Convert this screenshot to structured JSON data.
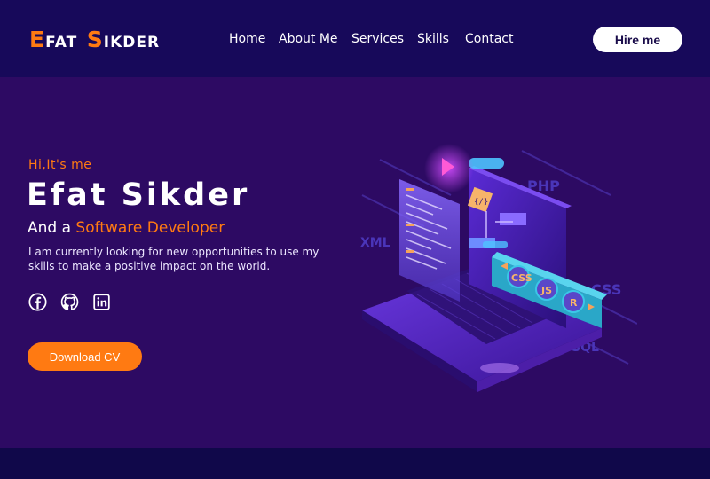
{
  "header": {
    "logo": {
      "first_initial": "E",
      "first_rest": "FAT",
      "last_initial": "S",
      "last_rest": "IKDER"
    },
    "nav": [
      "Home",
      "About Me",
      "Services",
      "Skills",
      "Contact"
    ],
    "cta_label": "Hire me"
  },
  "hero": {
    "greeting": "Hi,It's me",
    "name": "Efat Sikder",
    "role_prefix": "And a ",
    "role_highlight": "Software Developer",
    "description": "I am currently looking for new opportunities to use my skills to make a positive impact on the world.",
    "socials": [
      {
        "icon": "facebook-icon"
      },
      {
        "icon": "github-icon"
      },
      {
        "icon": "linkedin-icon"
      }
    ],
    "download_label": "Download CV",
    "illustration_tags": [
      "PHP",
      "XML",
      "CSS",
      "SQL",
      "CSS",
      "JS",
      "R"
    ]
  },
  "colors": {
    "header_bg": "#17095a",
    "hero_bg": "#2d0a63",
    "accent": "#ff7a12",
    "text": "#ffffff"
  }
}
